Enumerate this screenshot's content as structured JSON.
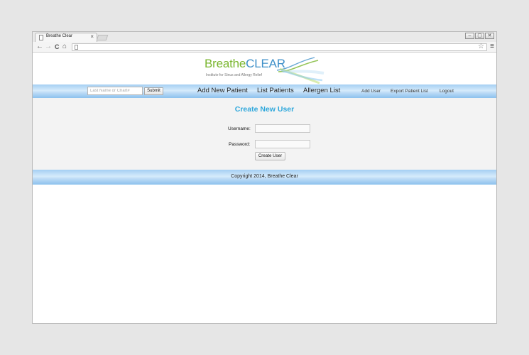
{
  "browser": {
    "tab_title": "Breathe Clear",
    "tab_close": "×",
    "window_buttons": [
      "–",
      "▢",
      "✕"
    ],
    "nav_glyphs": {
      "back": "←",
      "forward": "→",
      "reload": "C",
      "home": "⌂"
    },
    "star": "☆",
    "menu": "≡"
  },
  "logo": {
    "brand_part1": "Breathe",
    "brand_part2": "CLEAR",
    "tagline": "Institute for Sinus and Allergy Relief",
    "colors": {
      "breathe": "#7ab62f",
      "clear": "#3d8fc8"
    }
  },
  "nav": {
    "search_placeholder": "Last Name or Chart#",
    "submit_label": "Submit",
    "primary_links": [
      "Add New Patient",
      "List Patients",
      "Allergen List"
    ],
    "secondary_links": [
      "Add User",
      "Export Patient List",
      "Logout"
    ]
  },
  "form": {
    "title": "Create New User",
    "username_label": "Username:",
    "password_label": "Password:",
    "username_value": "",
    "password_value": "",
    "submit_label": "Create User"
  },
  "footer": {
    "copyright": "Copyright 2014, Breathe Clear"
  }
}
